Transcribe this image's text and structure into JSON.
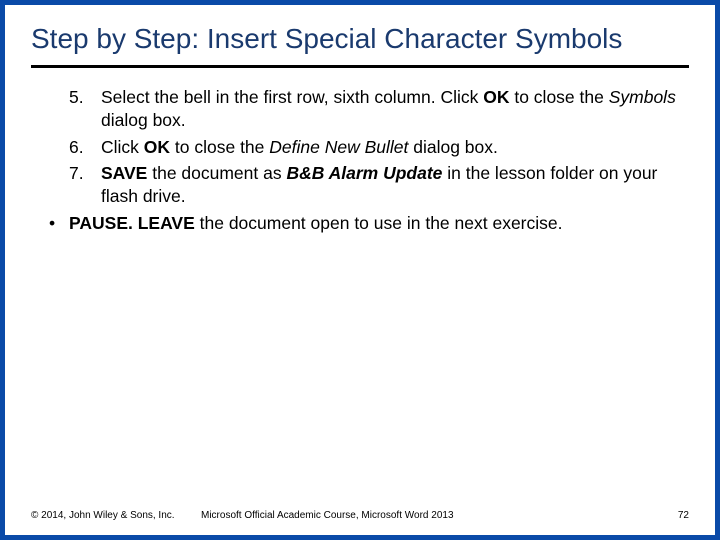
{
  "title": "Step by Step: Insert Special Character Symbols",
  "steps": [
    {
      "num": "5.",
      "html": "Select the bell in the first row, sixth column. Click <b>OK</b> to close the <i>Symbols</i> dialog box."
    },
    {
      "num": "6.",
      "html": "Click <b>OK</b> to close the <i>Define New Bullet</i> dialog box."
    },
    {
      "num": "7.",
      "html": " <b>SAVE</b> the document as <b><i>B&amp;B Alarm Update</i></b> in the lesson folder on your flash drive."
    }
  ],
  "bullet": {
    "mark": "•",
    "html": "<b>PAUSE. LEAVE</b> the document open to use in the next exercise."
  },
  "footer": {
    "left": "© 2014, John Wiley & Sons, Inc.",
    "center": "Microsoft Official Academic Course, Microsoft Word 2013",
    "right": "72"
  }
}
